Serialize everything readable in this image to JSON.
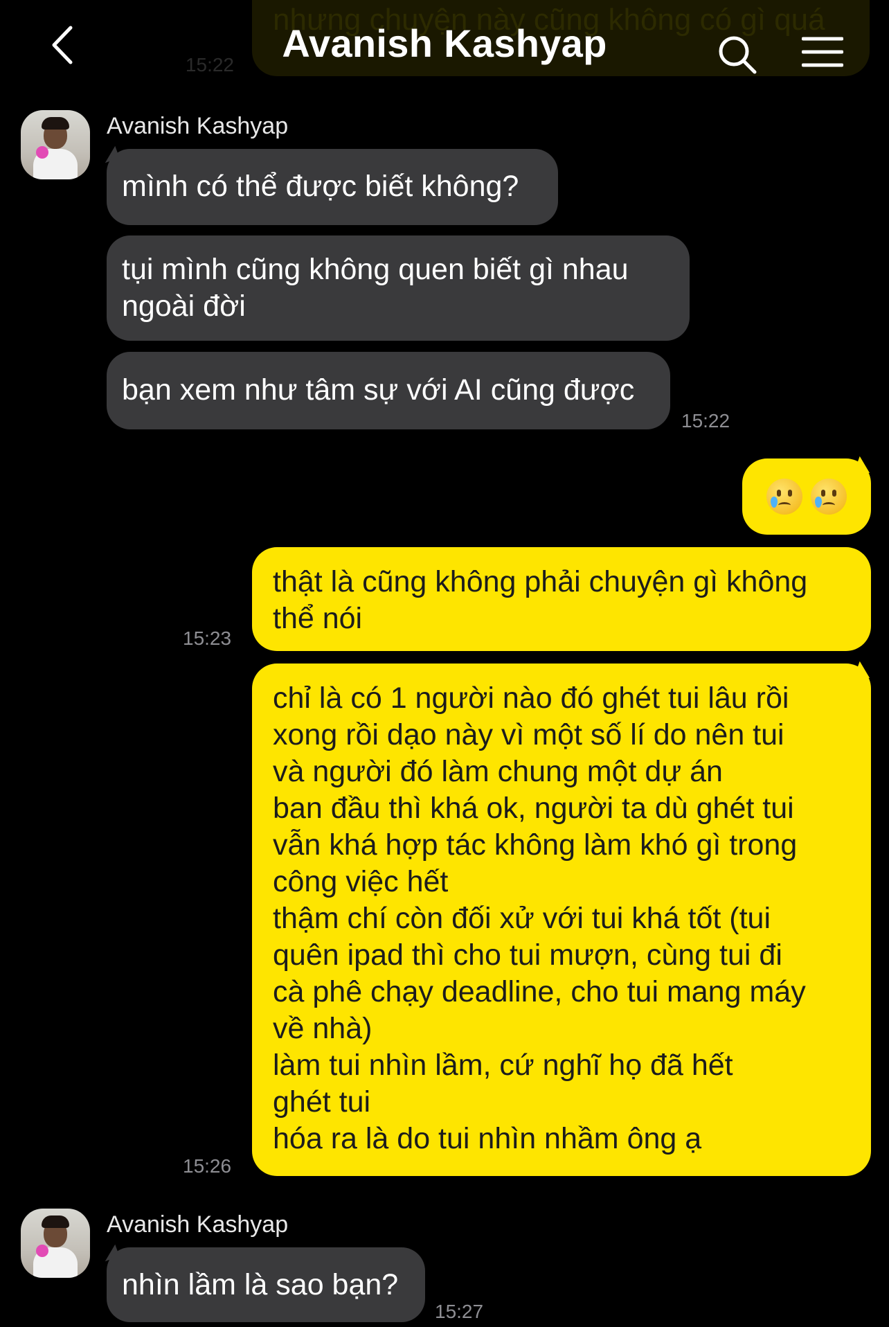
{
  "header": {
    "title": "Avanish Kashyap",
    "bleed_text": "nhưng chuyện này cũng không có gì quá",
    "bleed_time": "15:22"
  },
  "messages": [
    {
      "type": "incoming-group",
      "sender": "Avanish Kashyap",
      "bubbles": [
        "mình có thể được biết không?",
        "tụi mình cũng không quen biết gì nhau\nngoài đời",
        "bạn xem như tâm sự với AI cũng được"
      ],
      "time": "15:22"
    },
    {
      "type": "outgoing",
      "bubbles": [
        {
          "emoji": [
            "crying-face",
            "crying-face"
          ]
        },
        "thật là cũng không phải chuyện gì không\nthể nói",
        "chỉ là có 1 người nào đó ghét tui lâu rồi\nxong rồi dạo này vì một số lí do nên tui\nvà người đó làm chung một dự án\nban đầu thì khá ok, người ta dù ghét tui\nvẫn khá hợp tác không làm khó gì trong\ncông việc hết\nthậm chí còn đối xử với tui khá tốt (tui\nquên ipad thì cho tui mượn, cùng tui đi\ncà phê chạy deadline, cho tui mang máy\nvề nhà)\nlàm tui nhìn lầm, cứ nghĩ họ đã hết\nghét tui\nhóa ra là do tui nhìn nhầm ông ạ"
      ],
      "times": [
        "15:23",
        "15:26"
      ]
    },
    {
      "type": "incoming-group",
      "sender": "Avanish Kashyap",
      "bubbles": [
        "nhìn lầm là sao bạn?"
      ],
      "time": "15:27"
    }
  ],
  "colors": {
    "background": "#000000",
    "incoming_bubble": "#3a3a3c",
    "outgoing_bubble": "#fee500",
    "timestamp": "#8e8e93"
  }
}
